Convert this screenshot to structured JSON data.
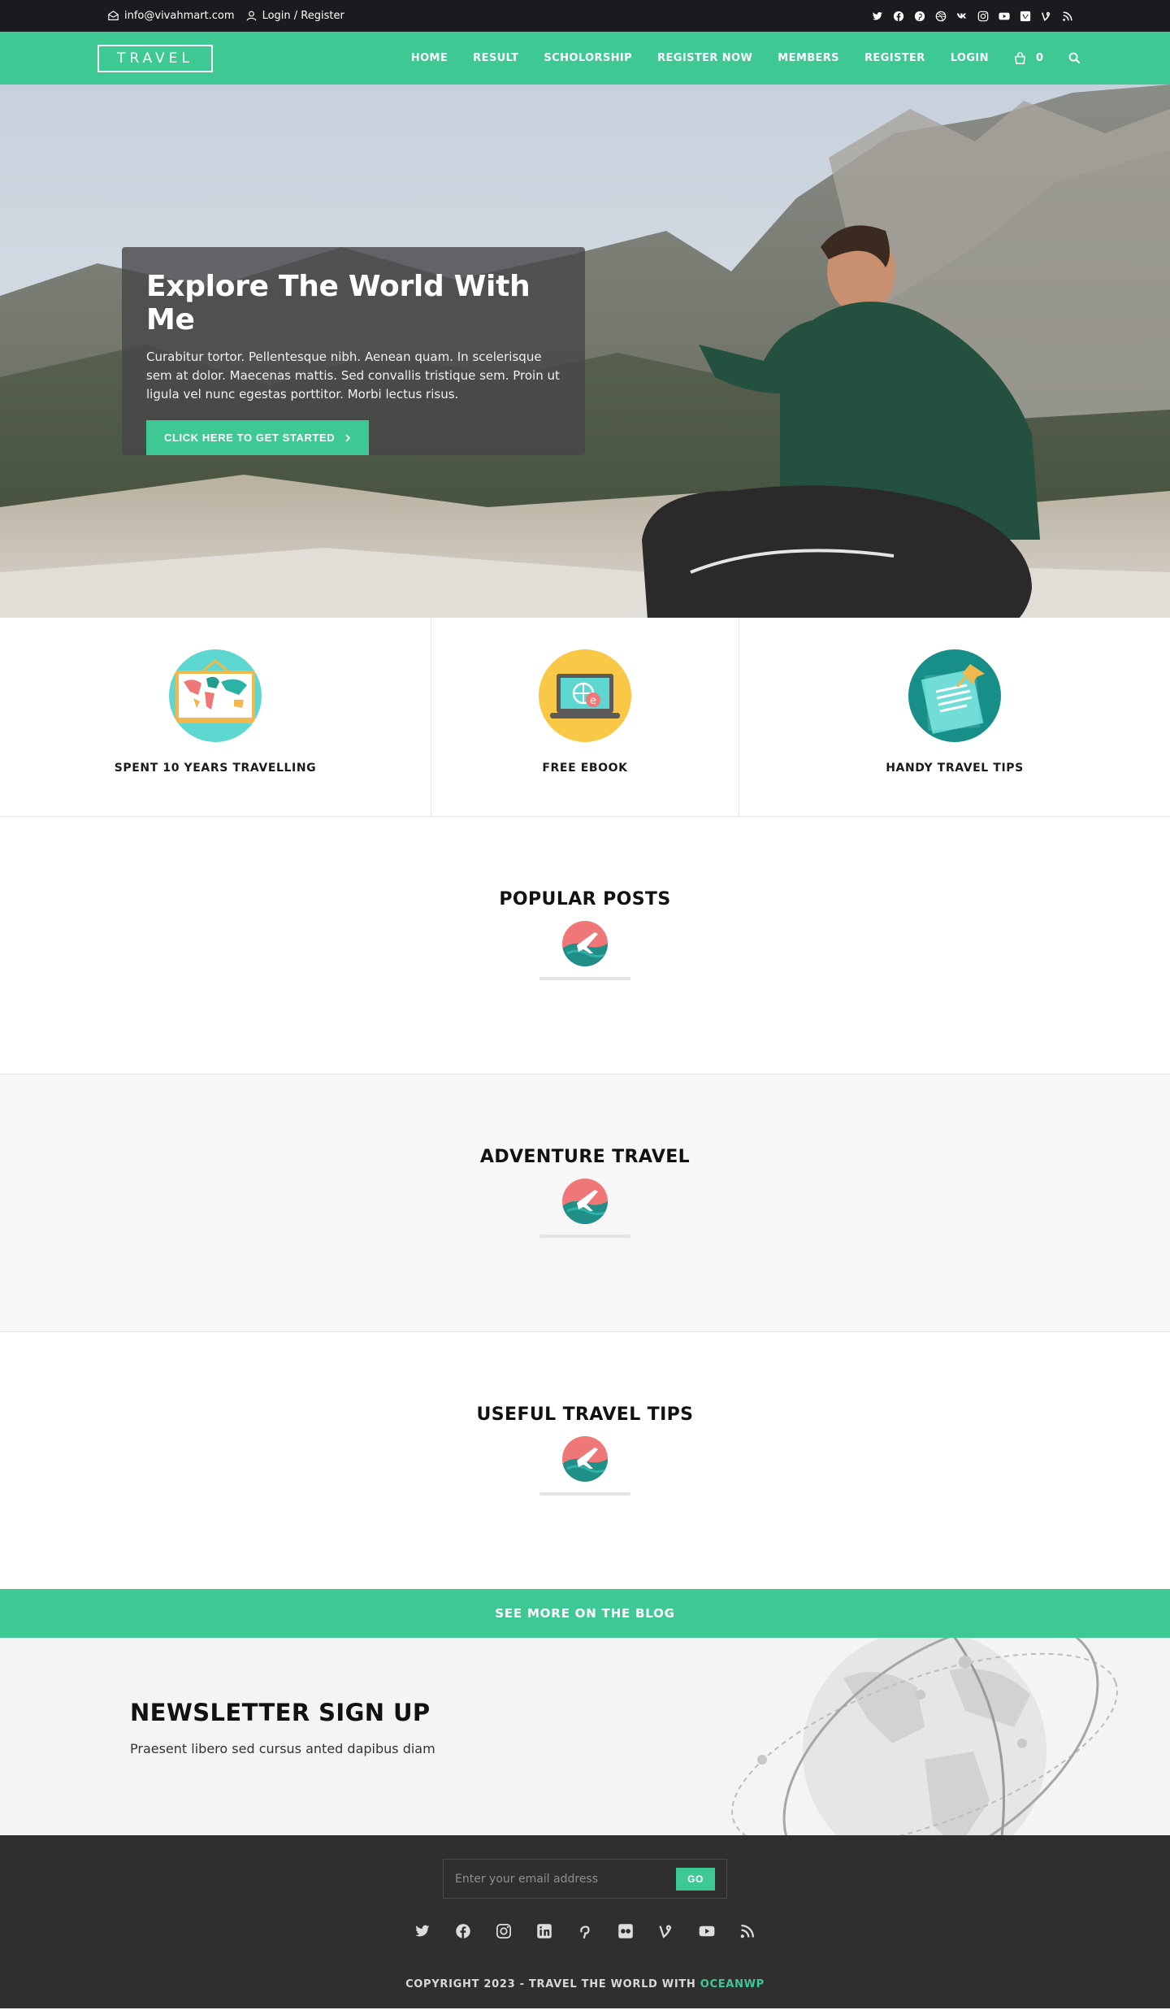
{
  "topbar": {
    "email": "info@vivahmart.com",
    "login": "Login / Register",
    "socials": [
      "twitter-icon",
      "facebook-icon",
      "pinterest-icon",
      "dribbble-icon",
      "vk-icon",
      "instagram-icon",
      "youtube-icon",
      "vimeo-icon",
      "vine-icon",
      "rss-icon"
    ]
  },
  "nav": {
    "logo": "TRAVEL",
    "items": [
      "HOME",
      "RESULT",
      "SCHOLORSHIP",
      "REGISTER NOW",
      "MEMBERS",
      "REGISTER",
      "LOGIN"
    ],
    "cart_count": "0"
  },
  "hero": {
    "title": "Explore The World With Me",
    "text": "Curabitur tortor. Pellentesque nibh. Aenean quam. In scelerisque sem at dolor. Maecenas mattis. Sed convallis tristique sem. Proin ut ligula vel nunc egestas porttitor. Morbi lectus risus.",
    "button": "CLICK HERE TO GET STARTED"
  },
  "features": [
    {
      "label": "SPENT 10 YEARS TRAVELLING",
      "icon": "world-map-icon"
    },
    {
      "label": "FREE EBOOK",
      "icon": "ebook-laptop-icon"
    },
    {
      "label": "HANDY TRAVEL TIPS",
      "icon": "note-pin-icon"
    }
  ],
  "sections": [
    {
      "title": "POPULAR POSTS"
    },
    {
      "title": "ADVENTURE TRAVEL"
    },
    {
      "title": "USEFUL TRAVEL TIPS"
    }
  ],
  "see_more": "SEE MORE ON THE BLOG",
  "newsletter": {
    "title": "NEWSLETTER SIGN UP",
    "text": "Praesent libero sed cursus anted dapibus diam"
  },
  "footer": {
    "email_placeholder": "Enter your email address",
    "go": "GO",
    "socials": [
      "twitter-icon",
      "facebook-icon",
      "instagram-icon",
      "linkedin-icon",
      "pinterest-icon",
      "flickr-icon",
      "vine-icon",
      "youtube-icon",
      "rss-icon"
    ],
    "copyright_prefix": "COPYRIGHT 2023 - TRAVEL THE WORLD WITH ",
    "copyright_brand": "OCEANWP"
  },
  "colors": {
    "accent": "#3ec994",
    "dark": "#1b1b1f",
    "footer": "#2f2f2f"
  }
}
